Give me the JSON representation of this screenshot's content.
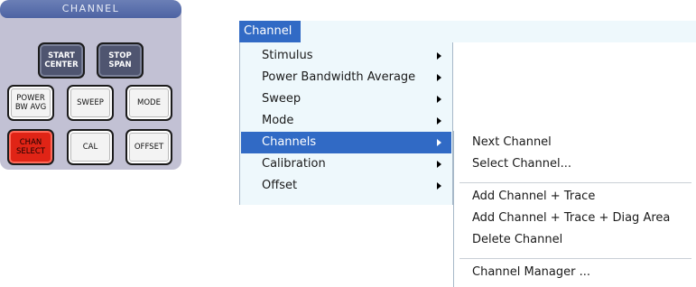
{
  "panel": {
    "title": "CHANNEL",
    "keys": [
      {
        "label": "START\nCENTER"
      },
      {
        "label": "STOP\nSPAN"
      },
      {
        "label": "POWER\nBW AVG"
      },
      {
        "label": "SWEEP"
      },
      {
        "label": "MODE"
      },
      {
        "label": "CHAN\nSELECT"
      },
      {
        "label": "CAL"
      },
      {
        "label": "OFFSET"
      }
    ]
  },
  "menu": {
    "title": "Channel",
    "items": [
      {
        "label": "Stimulus",
        "has_submenu": true
      },
      {
        "label": "Power Bandwidth Average",
        "has_submenu": true
      },
      {
        "label": "Sweep",
        "has_submenu": true
      },
      {
        "label": "Mode",
        "has_submenu": true
      },
      {
        "label": "Channels",
        "has_submenu": true,
        "highlighted": true
      },
      {
        "label": "Calibration",
        "has_submenu": true
      },
      {
        "label": "Offset",
        "has_submenu": true
      }
    ]
  },
  "submenu": {
    "items": [
      {
        "label": "Next Channel"
      },
      {
        "label": "Select Channel..."
      },
      {
        "label": "Add Channel + Trace"
      },
      {
        "label": "Add Channel + Trace + Diag Area"
      },
      {
        "label": "Delete Channel"
      },
      {
        "label": "Channel Manager ..."
      }
    ]
  },
  "colors": {
    "highlight": "#316ac5",
    "menu_background": "#eef8fc",
    "panel_background": "#c2c1d4",
    "panel_title": "#5068a8",
    "chan_select_key": "#e02416",
    "dark_key": "#4f5570"
  }
}
